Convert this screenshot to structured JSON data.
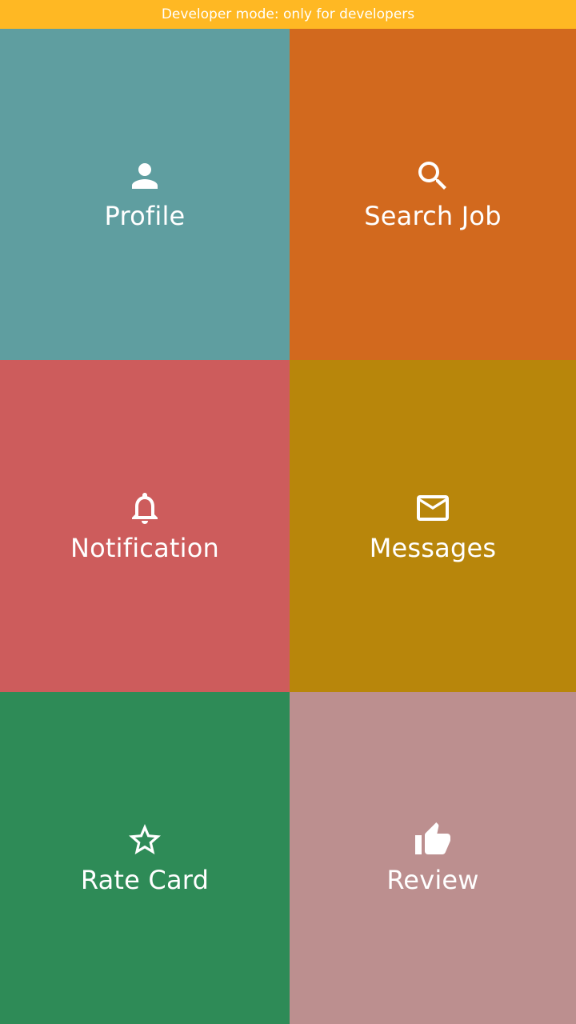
{
  "banner": {
    "text": "Developer mode: only for developers",
    "color": "#FFB823"
  },
  "tiles": [
    {
      "id": "profile",
      "label": "Profile",
      "icon": "person-icon",
      "color": "#5F9EA0"
    },
    {
      "id": "search-job",
      "label": "Search Job",
      "icon": "search-icon",
      "color": "#D2691E"
    },
    {
      "id": "notification",
      "label": "Notification",
      "icon": "bell-icon",
      "color": "#CD5C5C"
    },
    {
      "id": "messages",
      "label": "Messages",
      "icon": "mail-icon",
      "color": "#B8860B"
    },
    {
      "id": "rate-card",
      "label": "Rate Card",
      "icon": "star-outline-icon",
      "color": "#2E8B57"
    },
    {
      "id": "review",
      "label": "Review",
      "icon": "thumb-up-icon",
      "color": "#BC8F8F"
    }
  ]
}
